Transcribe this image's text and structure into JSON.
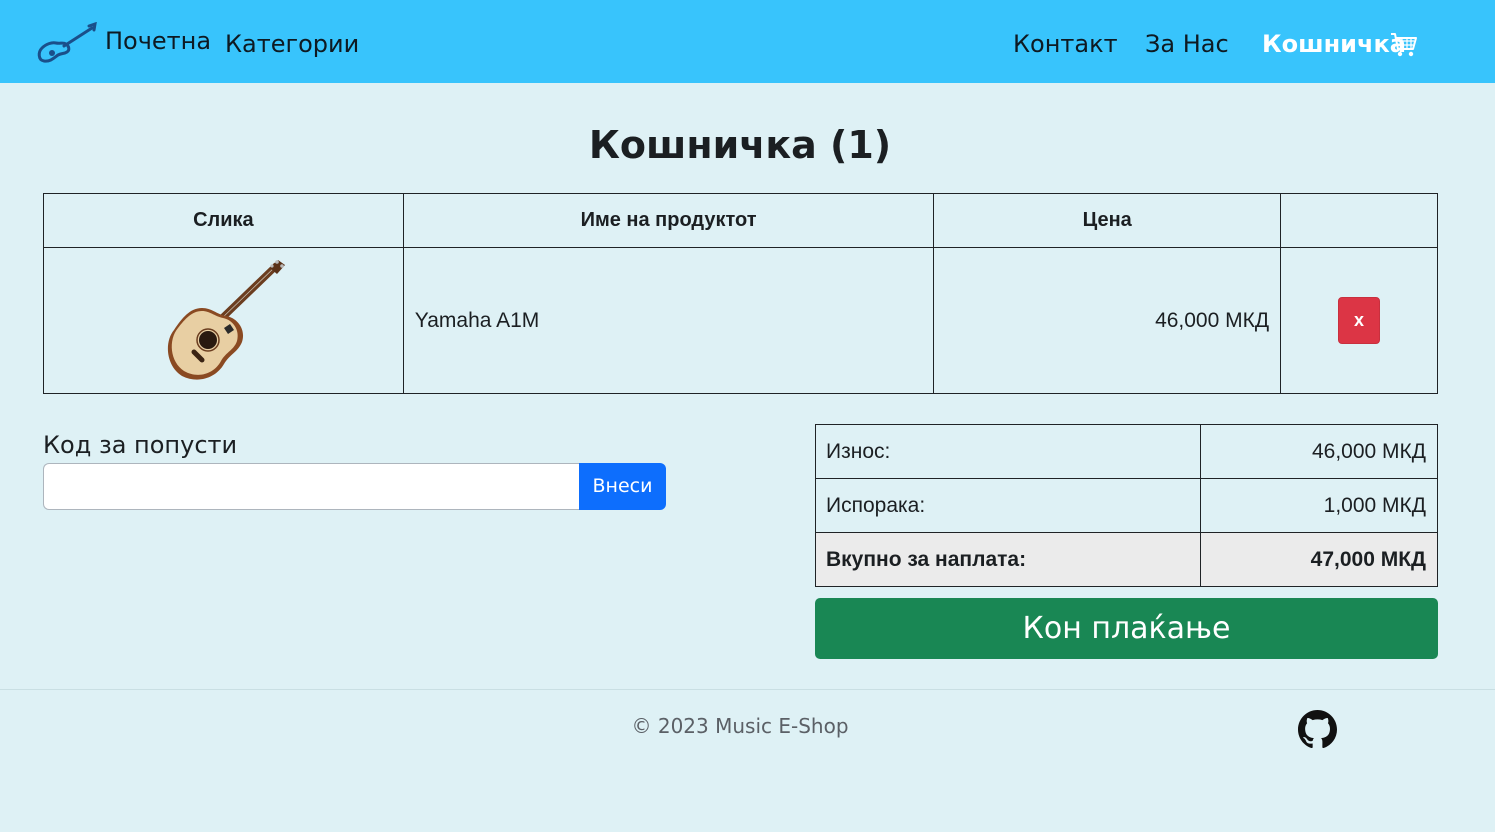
{
  "navbar": {
    "home_label": "Почетна",
    "categories_label": "Категории",
    "contact_label": "Контакт",
    "about_label": "За Нас",
    "cart_label": "Кошничка",
    "bg_color": "#38c4fc",
    "logo_icon": "guitar-logo-icon",
    "cart_icon": "shopping-cart-icon"
  },
  "page": {
    "title": "Кошничка (1)"
  },
  "cart_table": {
    "headers": [
      "Слика",
      "Име на продуктот",
      "Цена",
      ""
    ],
    "rows": [
      {
        "image_icon": "acoustic-guitar-image",
        "name": "Yamaha A1M",
        "price": "46,000 МКД",
        "remove_label": "x"
      }
    ]
  },
  "discount": {
    "label": "Код за попусти",
    "input_value": "",
    "submit_label": "Внеси"
  },
  "summary": {
    "subtotal_label": "Износ:",
    "subtotal_value": "46,000 МКД",
    "shipping_label": "Испорака:",
    "shipping_value": "1,000 МКД",
    "total_label": "Вкупно за наплата:",
    "total_value": "47,000 МКД"
  },
  "checkout": {
    "label": "Кон плаќање",
    "color": "#198754"
  },
  "footer": {
    "copyright": "© 2023 Music E-Shop",
    "github_icon": "github-icon"
  }
}
